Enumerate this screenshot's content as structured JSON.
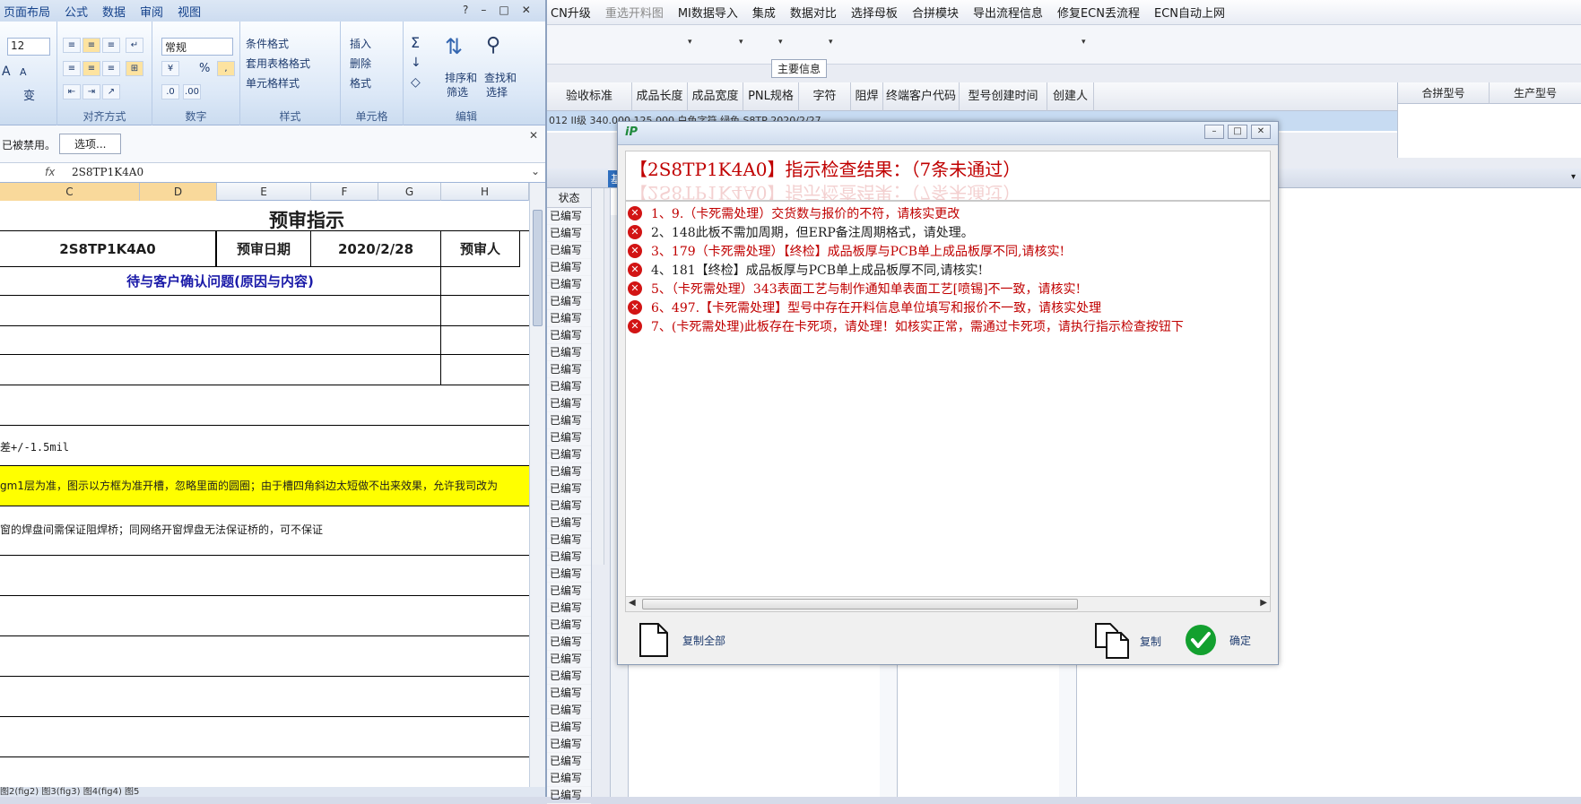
{
  "bgapp": {
    "menu": [
      "CN升级",
      "重选开料图",
      "MI数据导入",
      "集成",
      "数据对比",
      "选择母板",
      "合拼模块",
      "导出流程信息",
      "修复ECN丢流程",
      "ECN自动上网"
    ],
    "dropdown_arrow": "▾",
    "group_label": "主要信息",
    "columns": [
      "验收标准",
      "成品长度",
      "成品宽度",
      "PNL规格",
      "字符",
      "阻焊",
      "终端客户代码",
      "型号创建时间",
      "创建人"
    ],
    "row": "012 II级   340.000   125.000        白色字符   绿色   S8TP        2020/2/27",
    "right_columns": [
      "合拼型号",
      "生产型号"
    ],
    "status_header": "状态",
    "status_items": [
      "已编写",
      "已编写",
      "已编写",
      "已编写",
      "已编写",
      "已编写",
      "已编写",
      "已编写",
      "已编写",
      "已编写",
      "已编写",
      "已编写",
      "已编写",
      "已编写",
      "已编写",
      "已编写",
      "已编写",
      "已编写",
      "已编写",
      "已编写",
      "已编写",
      "已编写",
      "已编写",
      "已编写",
      "已编写",
      "已编写",
      "已编写",
      "已编写",
      "已编写",
      "已编写",
      "已编写",
      "已编写",
      "已编写",
      "已编写",
      "已编写"
    ],
    "strip_text": "基"
  },
  "excel": {
    "tabs": [
      "页面布局",
      "公式",
      "数据",
      "审阅",
      "视图"
    ],
    "font_size": "12",
    "number_format": "常规",
    "ribbon": {
      "cond_format": "条件格式",
      "table_format": "套用表格格式",
      "cell_style": "单元格样式",
      "insert": "插入",
      "delete": "删除",
      "format": "格式",
      "sort_filter_1": "排序和",
      "sort_filter_2": "筛选",
      "find_select_1": "查找和",
      "find_select_2": "选择",
      "sigma": "Σ",
      "percent": "%",
      "grow_font": "A",
      "shrink_font": "A",
      "fx": "fx"
    },
    "groups": [
      "对齐方式",
      "数字",
      "样式",
      "单元格",
      "编辑"
    ],
    "warning": "已被禁用。",
    "options_button": "选项...",
    "formula_value": "2S8TP1K4A0",
    "columns": [
      "C",
      "D",
      "E",
      "F",
      "G",
      "H"
    ],
    "sheet": {
      "title": "预审指示",
      "model": "2S8TP1K4A0",
      "date_label": "预审日期",
      "date": "2020/2/28",
      "reviewer_label": "预审人",
      "pending": "待与客户确认问题(原因与内容)",
      "note1": "差+/-1.5mil",
      "note2": "gm1层为准，图示以方框为准开槽，忽略里面的圆圈；由于槽四角斜边太短做不出来效果，允许我司改为",
      "note3": "窗的焊盘间需保证阻焊桥；同网络开窗焊盘无法保证桥的，可不保证"
    },
    "sheet_tabs": "图2(fig2)  图3(fig3)  图4(fig4)  图5"
  },
  "dialog": {
    "logo": "iP",
    "heading": "【2S8TP1K4A0】指示检查结果：（7条未通过）",
    "items": [
      {
        "text": "1、9.（卡死需处理）交货数与报价的不符，请核实更改",
        "color": "#c00000"
      },
      {
        "text": "2、148此板不需加周期，但ERP备注周期格式，请处理。",
        "color": "#1e1e1e"
      },
      {
        "text": "3、179（卡死需处理）【终检】成品板厚与PCB单上成品板厚不同,请核实!",
        "color": "#c00000"
      },
      {
        "text": "4、181【终检】成品板厚与PCB单上成品板厚不同,请核实!",
        "color": "#1e1e1e"
      },
      {
        "text": "5、（卡死需处理）343表面工艺与制作通知单表面工艺[喷锡]不一致，请核实!",
        "color": "#c00000"
      },
      {
        "text": "6、497.【卡死需处理】型号中存在开料信息单位填写和报价不一致，请核实处理",
        "color": "#c00000"
      },
      {
        "text": "7、(卡死需处理)此板存在卡死项，请处理！如核实正常，需通过卡死项，请执行指示检查按钮下",
        "color": "#c00000"
      }
    ],
    "copy_all": "复制全部",
    "copy": "复制",
    "ok": "确定"
  }
}
